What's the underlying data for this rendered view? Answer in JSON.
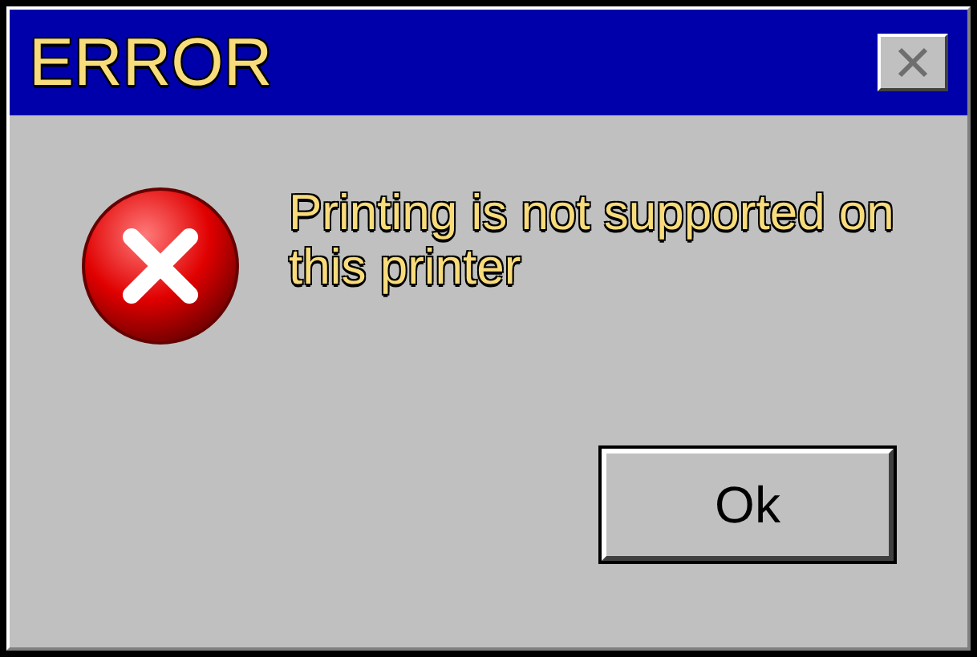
{
  "window": {
    "title": "ERROR"
  },
  "message": "Printing is not supported on this printer",
  "buttons": [
    "Ok"
  ]
}
